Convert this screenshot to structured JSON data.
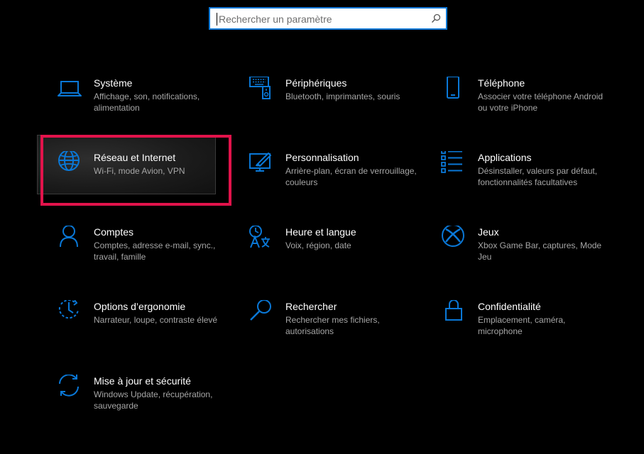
{
  "search": {
    "placeholder": "Rechercher un paramètre"
  },
  "colors": {
    "accent": "#0a78d7",
    "highlight": "#e2134b",
    "background": "#000000"
  },
  "tiles": [
    {
      "title": "Système",
      "desc": "Affichage, son, notifications, alimentation",
      "icon": "laptop-icon"
    },
    {
      "title": "Périphériques",
      "desc": "Bluetooth, imprimantes, souris",
      "icon": "devices-icon"
    },
    {
      "title": "Téléphone",
      "desc": "Associer votre téléphone Android ou votre iPhone",
      "icon": "phone-icon"
    },
    {
      "title": "Réseau et Internet",
      "desc": "Wi-Fi, mode Avion, VPN",
      "icon": "globe-icon"
    },
    {
      "title": "Personnalisation",
      "desc": "Arrière-plan, écran de verrouillage, couleurs",
      "icon": "paint-icon"
    },
    {
      "title": "Applications",
      "desc": "Désinstaller, valeurs par défaut, fonctionnalités facultatives",
      "icon": "apps-list-icon"
    },
    {
      "title": "Comptes",
      "desc": "Comptes, adresse e-mail, sync., travail, famille",
      "icon": "person-icon"
    },
    {
      "title": "Heure et langue",
      "desc": "Voix, région, date",
      "icon": "time-language-icon"
    },
    {
      "title": "Jeux",
      "desc": "Xbox Game Bar, captures, Mode Jeu",
      "icon": "xbox-icon"
    },
    {
      "title": "Options d’ergonomie",
      "desc": "Narrateur, loupe, contraste élevé",
      "icon": "ease-of-access-icon"
    },
    {
      "title": "Rechercher",
      "desc": "Rechercher mes fichiers, autorisations",
      "icon": "search-icon"
    },
    {
      "title": "Confidentialité",
      "desc": "Emplacement, caméra, microphone",
      "icon": "lock-icon"
    },
    {
      "title": "Mise à jour et sécurité",
      "desc": "Windows Update, récupération, sauvegarde",
      "icon": "sync-icon"
    }
  ]
}
